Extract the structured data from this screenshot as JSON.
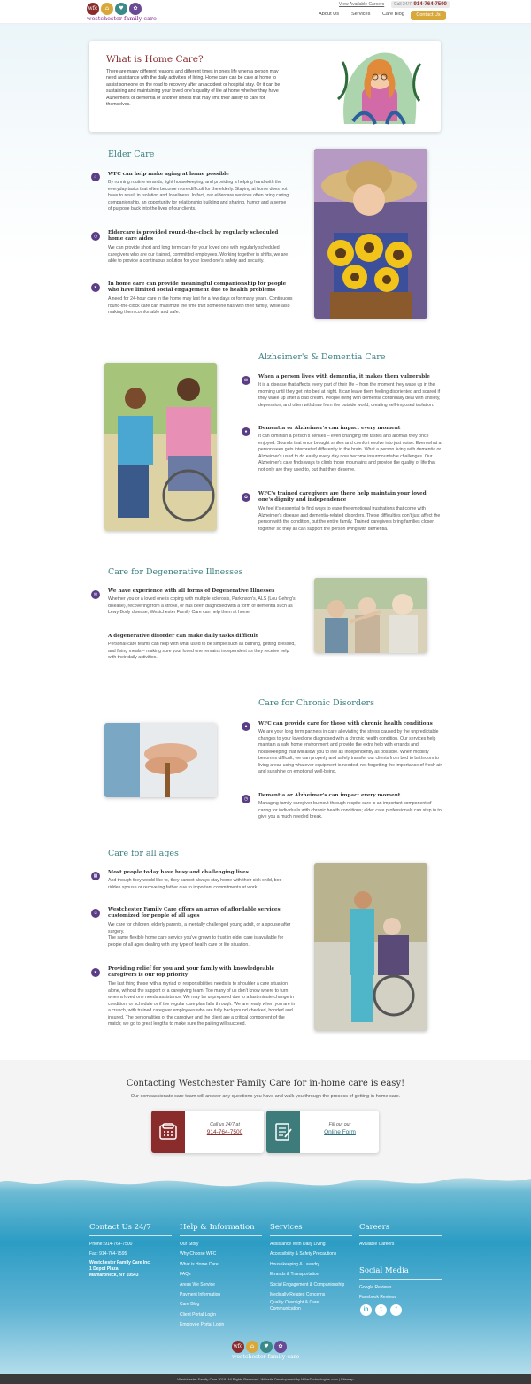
{
  "header": {
    "logo_letters": [
      "wfc",
      "",
      "",
      ""
    ],
    "logo_text": "westchester family care",
    "careers_link": "View Available Careers",
    "call_label": "Call 24/7:",
    "call_number": "914-764-7500",
    "nav": [
      "About Us",
      "Services",
      "Care Blog"
    ],
    "contact_button": "Contact Us"
  },
  "intro": {
    "title": "What is Home Care?",
    "text": "There are many different reasons and different times in one's life when a person may need assistance with the daily activities of living. Home care can be care at home to assist someone on the road to recovery after an accident or hospital stay. Or it can be sustaining and maintaining your loved one's quality of life at home whether they have Alzheimer's or dementia or another illness that may limit their ability to care for themselves."
  },
  "sections": [
    {
      "title": "Elder Care",
      "items": [
        {
          "icon": "home-icon",
          "title": "WFC can help make aging at home possible",
          "text": "By running routine errands, light housekeeping, and providing a helping hand with the everyday tasks that often become more difficult for the elderly. Staying at home does not have to result in isolation and loneliness. In fact, our eldercare services often bring caring companionship, an opportunity for relationship building and sharing, humor and a sense of purpose back into the lives of our clients."
        },
        {
          "icon": "clock-icon",
          "title": "Eldercare is provided round-the-clock by regularly scheduled home care aides",
          "text": "We can provide short and long term care for your loved one with regularly scheduled caregivers who are our trained, committed employees. Working together in shifts, we are able to provide a continuous solution for your loved one's safety and security."
        },
        {
          "icon": "heart-icon",
          "title": "In home care can provide meaningful companionship for people who have limited social engagement due to health problems",
          "text": "A need for 24-hour care in the home may last for a few days or for many years. Continuous round-the-clock care can maximize the time that someone has with their family, while also making them comfortable and safe."
        }
      ]
    },
    {
      "title": "Alzheimer's & Dementia Care",
      "items": [
        {
          "icon": "chat-icon",
          "title": "When a person lives with dementia, it makes them vulnerable",
          "text": "It is a disease that affects every part of their life – from the moment they wake up in the morning until they get into bed at night. It can leave them feeling disoriented and scared if they wake up after a bad dream. People living with dementia continually deal with anxiety, depression, and often withdraw from the outside world, creating self-imposed isolation."
        },
        {
          "icon": "drop-icon",
          "title": "Dementia or Alzheimer's can impact every moment",
          "text": "It can diminish a person's senses – even changing the tastes and aromas they once enjoyed. Sounds that once brought smiles and comfort evolve into just noise. Even what a person sees gets interpreted differently in the brain. What a person living with dementia or Alzheimer's used to do easily every day now become insurmountable challenges. Our Alzheimer's care finds ways to climb those mountains and provide the quality of life that not only are they used to, but that they deserve."
        },
        {
          "icon": "brain-icon",
          "title": "WFC's trained caregivers are there help maintain your loved one's dignity and independence",
          "text": "We feel it's essential to find ways to ease the emotional frustrations that come with Alzheimer's disease and dementia-related disorders. These difficulties don't just affect the person with the condition, but the entire family. Trained caregivers bring families closer together so they all can support the person living with dementia."
        }
      ]
    },
    {
      "title": "Care for Degenerative Illnesses",
      "items": [
        {
          "icon": "chat-icon",
          "title": "We have experience with all forms of Degenerative Illnesses",
          "text": "Whether you or a loved one is coping with multiple sclerosis, Parkinson's, ALS (Lou Gehrig's disease), recovering from a stroke, or has been diagnosed with a form of dementia such as Lewy Body disease, Westchester Family Care can help them at home."
        },
        {
          "icon": "",
          "title": "A degenerative disorder can make daily tasks difficult",
          "text": "Personal-care teams can help with what used to be simple such as bathing, getting dressed, and fixing meals – making sure your loved one remains independent as they receive help with their daily activities."
        }
      ]
    },
    {
      "title": "Care for Chronic Disorders",
      "items": [
        {
          "icon": "drop-icon",
          "title": "WFC can provide care for those with chronic health conditions",
          "text": "We are your long term partners in care alleviating the stress caused by the unpredictable changes to your loved one diagnosed with a chronic health condition. Our services help maintain a safe home environment and provide the extra help with errands and housekeeping that will allow you to live as independently as possible. When mobility becomes difficult, we can properly and safely transfer our clients from bed to bathroom to living areas using whatever equipment is needed, not forgetting the importance of fresh air and sunshine on emotional well-being."
        },
        {
          "icon": "clock-icon",
          "title": "Dementia or Alzheimer's can impact every moment",
          "text": "Managing family caregiver burnout through respite care is an important component of caring for individuals with chronic health conditions; elder care professionals can step in to give you a much needed break."
        }
      ]
    },
    {
      "title": "Care for all ages",
      "items": [
        {
          "icon": "calendar-icon",
          "title": "Most people today have busy and challenging lives",
          "text": "And though they would like to, they cannot always stay home with their sick child, bed-ridden spouse or recovering father due to important commitments at work."
        },
        {
          "icon": "people-icon",
          "title": "Westchester Family Care offers an array of affordable services customized for people of all ages",
          "text": "We care for children, elderly parents, a mentally challenged young adult, or a spouse after surgery.\nThe same flexible home care service you've grown to trust in elder care is available for people of all ages dealing with any type of health care or life situation."
        },
        {
          "icon": "heart-icon",
          "title": "Providing relief for you and your family with knowledgeable caregivers is our top priority",
          "text": "The last thing those with a myriad of responsibilities needs is to shoulder a care situation alone, without the support of a caregiving team. Too many of us don't know where to turn when a loved one needs assistance. We may be unprepared due to a last minute change in condition, or schedule or if the regular care plan falls through. We are ready when you are in a crunch, with trained caregiver employees who are fully background checked, bonded and insured. The personalities of the caregiver and the client are a critical component of the match; we go to great lengths to make sure the pairing will succeed."
        }
      ]
    }
  ],
  "cta": {
    "title": "Contacting Westchester Family Care for in-home care is easy!",
    "subtitle": "Our compassionate care team will answer any questions you have and walk you through the process of getting in-home care.",
    "call_label": "Call us 24/7 at",
    "call_value": "914-764-7500",
    "form_label": "Fill out our",
    "form_value": "Online Form"
  },
  "footer": {
    "contact_heading": "Contact Us 24/7",
    "contact_lines": [
      "Phone: 914-764-7500",
      "Fax: 914-764-7595"
    ],
    "address_lines": [
      "Westchester Family Care Inc.",
      "1 Depot Plaza",
      "Mamaroneck, NY 10543"
    ],
    "help_heading": "Help & Information",
    "help_links": [
      "Our Story",
      "Why Choose WFC",
      "What is Home Care",
      "FAQs",
      "Areas We Service",
      "Payment Information",
      "Care Blog",
      "Client Portal Login",
      "Employee Portal Login"
    ],
    "services_heading": "Services",
    "services_links": [
      "Assistance With Daily Living",
      "Accessibility & Safety Precautions",
      "Housekeeping & Laundry",
      "Errands & Transportation",
      "Social Engagement & Companionship",
      "Medically Related Concerns",
      "Quality Oversight & Care Communication"
    ],
    "careers_heading": "Careers",
    "careers_links": [
      "Available Careers"
    ],
    "social_heading": "Social Media",
    "social_links": [
      "Google Reviews",
      "Facebook Reviews"
    ],
    "social_icons": [
      "in",
      "t",
      "f"
    ],
    "logo_text": "westchester family care",
    "copyright": "Westchester Family Care 2018. All Rights Reserved. Website Development by MillerTechnologies.com | Sitemap"
  }
}
